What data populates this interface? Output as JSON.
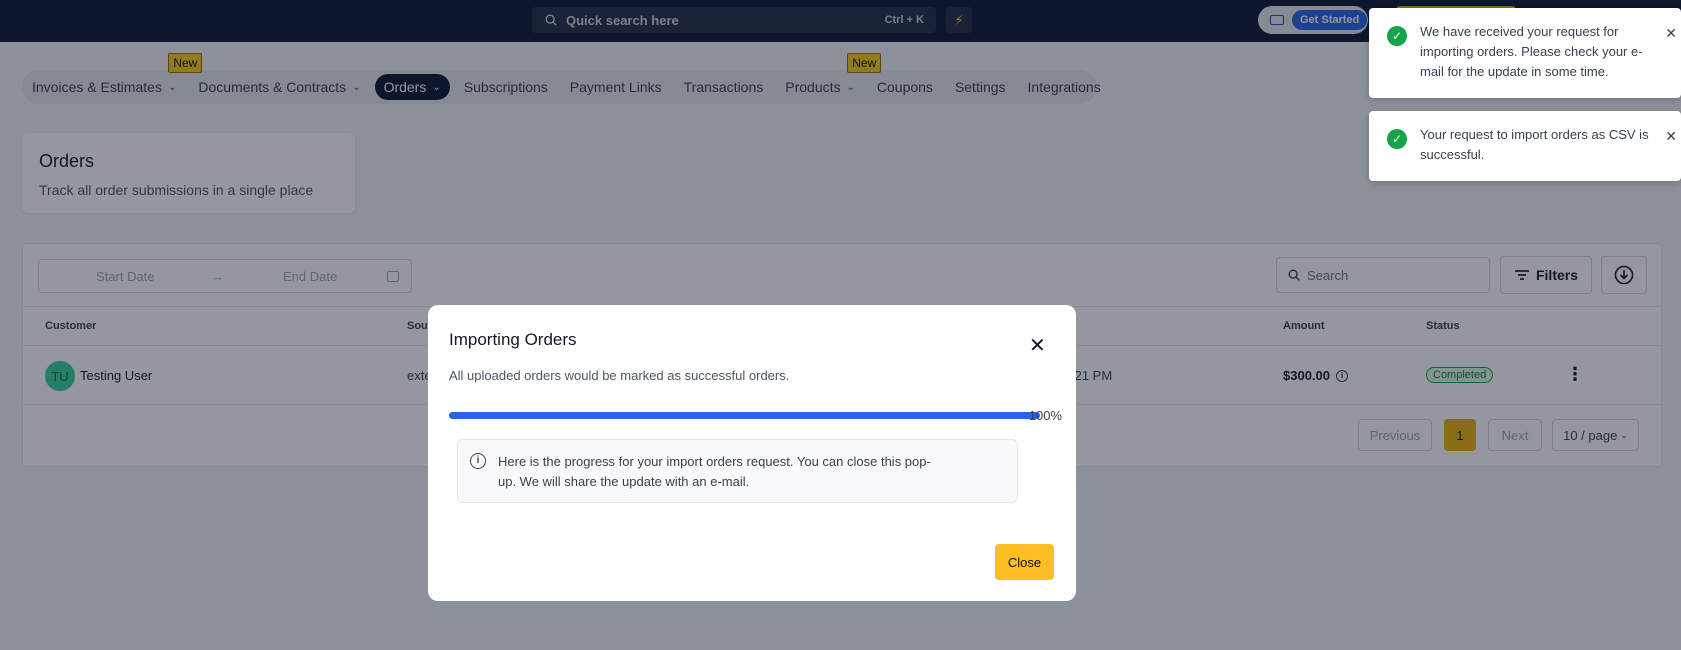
{
  "topbar": {
    "search_placeholder": "Quick search here",
    "search_shortcut": "Ctrl + K",
    "get_started": "Get Started"
  },
  "nav": {
    "items": [
      {
        "label": "Invoices & Estimates",
        "dropdown": true,
        "badge": ""
      },
      {
        "label": "Documents & Contracts",
        "dropdown": true,
        "badge": "New"
      },
      {
        "label": "Orders",
        "dropdown": true,
        "badge": "",
        "active": true
      },
      {
        "label": "Subscriptions",
        "dropdown": false,
        "badge": ""
      },
      {
        "label": "Payment Links",
        "dropdown": false,
        "badge": ""
      },
      {
        "label": "Transactions",
        "dropdown": false,
        "badge": ""
      },
      {
        "label": "Products",
        "dropdown": true,
        "badge": "New"
      },
      {
        "label": "Coupons",
        "dropdown": false,
        "badge": ""
      },
      {
        "label": "Settings",
        "dropdown": false,
        "badge": ""
      },
      {
        "label": "Integrations",
        "dropdown": false,
        "badge": ""
      }
    ]
  },
  "header": {
    "title": "Orders",
    "subtitle": "Track all order submissions in a single place"
  },
  "filters": {
    "start_date_placeholder": "Start Date",
    "end_date_placeholder": "End Date",
    "arrow": "→",
    "search_placeholder": "Search",
    "filters_label": "Filters"
  },
  "table": {
    "columns": [
      "Customer",
      "Sou",
      "Amount",
      "Status"
    ],
    "rows": [
      {
        "initials": "TU",
        "customer": "Testing User",
        "source": "exte",
        "date": ":21 PM",
        "amount": "$300.00",
        "status": "Completed"
      }
    ]
  },
  "pagination": {
    "previous": "Previous",
    "current": "1",
    "next": "Next",
    "page_size": "10 / page"
  },
  "modal": {
    "title": "Importing Orders",
    "description": "All uploaded orders would be marked as successful orders.",
    "progress_percent": 100,
    "progress_label": "100%",
    "note_line1": "Here is the progress for your import orders request. You can close this pop-",
    "note_line2": "up. We will share the update with an e-mail.",
    "close_label": "Close"
  },
  "toasts": [
    {
      "line1": "We have received your request for",
      "line2": "importing orders. Please check your e-",
      "line3": "mail for the update in some time."
    },
    {
      "line1": "Your request to import orders as CSV is",
      "line2": "successful."
    }
  ],
  "colors": {
    "topbar": "#0b1532",
    "accent_yellow": "#fbbf24",
    "progress_blue": "#2563eb",
    "success_green": "#16a34a"
  }
}
